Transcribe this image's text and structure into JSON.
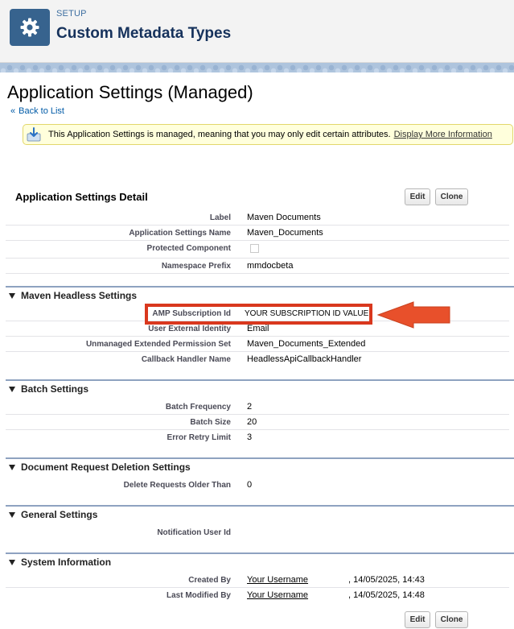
{
  "header": {
    "kicker": "SETUP",
    "title": "Custom Metadata Types"
  },
  "page": {
    "title": "Application Settings (Managed)",
    "back_link": "Back to List"
  },
  "info": {
    "message": "This Application Settings is managed, meaning that you may only edit certain attributes.",
    "link": "Display More Information"
  },
  "detail": {
    "title": "Application Settings Detail",
    "edit_label": "Edit",
    "clone_label": "Clone",
    "fields": [
      {
        "label": "Label",
        "value": "Maven Documents"
      },
      {
        "label": "Application Settings Name",
        "value": "Maven_Documents"
      },
      {
        "label": "Protected Component",
        "value": ""
      },
      {
        "label": "Namespace Prefix",
        "value": "mmdocbeta"
      }
    ]
  },
  "sections": [
    {
      "title": "Maven Headless Settings",
      "fields": [
        {
          "label": "AMP Subscription Id",
          "value": "YOUR SUBSCRIPTION ID VALUE"
        },
        {
          "label": "User External Identity",
          "value": "Email"
        },
        {
          "label": "Unmanaged Extended Permission Set",
          "value": "Maven_Documents_Extended"
        },
        {
          "label": "Callback Handler Name",
          "value": "HeadlessApiCallbackHandler"
        }
      ]
    },
    {
      "title": "Batch Settings",
      "fields": [
        {
          "label": "Batch Frequency",
          "value": "2"
        },
        {
          "label": "Batch Size",
          "value": "20"
        },
        {
          "label": "Error Retry Limit",
          "value": "3"
        }
      ]
    },
    {
      "title": "Document Request Deletion Settings",
      "fields": [
        {
          "label": "Delete Requests Older Than",
          "value": "0"
        }
      ]
    },
    {
      "title": "General Settings",
      "fields": [
        {
          "label": "Notification User Id",
          "value": ""
        }
      ]
    },
    {
      "title": "System Information",
      "fields": [
        {
          "label": "Created By",
          "value": "Your Username",
          "date": ", 14/05/2025, 14:43"
        },
        {
          "label": "Last Modified By",
          "value": "Your Username",
          "date": ", 14/05/2025, 14:48"
        }
      ]
    }
  ],
  "footer": {
    "edit_label": "Edit",
    "clone_label": "Clone"
  },
  "colors": {
    "highlight": "#d9381e",
    "arrow": "#e8502b",
    "header_tile": "#37638e"
  },
  "icons": {
    "header": "gear-icon",
    "info": "info-download-icon",
    "section_toggle": "triangle-down-icon"
  }
}
